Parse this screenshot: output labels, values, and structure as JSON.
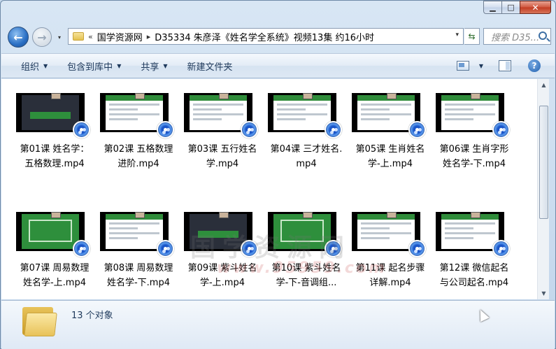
{
  "window": {
    "minimize_symbol": "▁",
    "maximize_symbol": "□",
    "close_symbol": "✕"
  },
  "address": {
    "chevrons": "«",
    "segments": [
      "国学资源网",
      "D35334 朱彦泽《姓名学全系统》视频13集 约16小时"
    ],
    "separator": "▸",
    "dropdown_symbol": "▾",
    "refresh_symbol": "⇆"
  },
  "search": {
    "placeholder": "搜索 D35..."
  },
  "toolbar": {
    "organize": "组织",
    "include_in_library": "包含到库中",
    "share": "共享",
    "new_folder": "新建文件夹",
    "dropdown_symbol": "▼",
    "help_symbol": "?"
  },
  "watermark": {
    "text": "国学资源网",
    "url": "www.95959.com"
  },
  "files": [
    {
      "line1": "第01课 姓名学：",
      "line2": "五格数理.mp4"
    },
    {
      "line1": "第02课 五格数理",
      "line2": "进阶.mp4"
    },
    {
      "line1": "第03课 五行姓名",
      "line2": "学.mp4"
    },
    {
      "line1": "第04课 三才姓名.",
      "line2": "mp4"
    },
    {
      "line1": "第05课 生肖姓名",
      "line2": "学-上.mp4"
    },
    {
      "line1": "第06课 生肖字形",
      "line2": "姓名学-下.mp4"
    },
    {
      "line1": "第07课 周易数理",
      "line2": "姓名学-上.mp4"
    },
    {
      "line1": "第08课 周易数理",
      "line2": "姓名学-下.mp4"
    },
    {
      "line1": "第09课 紫斗姓名",
      "line2": "学-上.mp4"
    },
    {
      "line1": "第10课 紫斗姓名",
      "line2": "学-下-音调组..."
    },
    {
      "line1": "第11课 起名步骤",
      "line2": "详解.mp4"
    },
    {
      "line1": "第12课 微信起名",
      "line2": "与公司起名.mp4"
    }
  ],
  "status": {
    "count": "13 个对象"
  },
  "scrollbar": {
    "up_symbol": "▲",
    "down_symbol": "▼"
  }
}
